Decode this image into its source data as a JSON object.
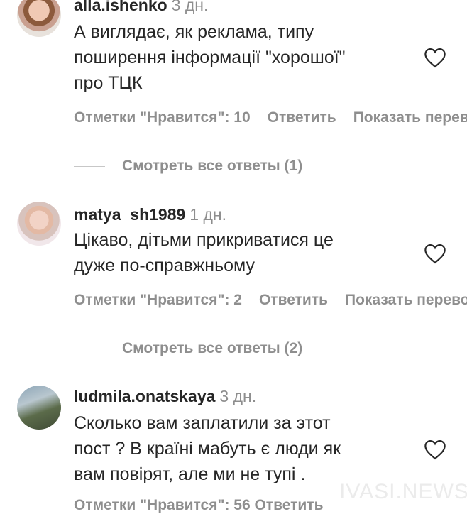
{
  "comments": [
    {
      "username": "alla.ishenko",
      "time": "3 дн.",
      "lines": [
        "А виглядає, як реклама, типу",
        "поширення інформації \"хорошої\"",
        "про ТЦК"
      ],
      "likes": "Отметки \"Нравится\": 10",
      "reply": "Ответить",
      "more": "Показать перевод",
      "view_replies": "Смотреть все ответы (1)"
    },
    {
      "username": "matya_sh1989",
      "time": "1 дн.",
      "lines": [
        "Цікаво, дітьми прикриватися це",
        "дуже по-справжньому"
      ],
      "likes": "Отметки \"Нравится\": 2",
      "reply": "Ответить",
      "more": "Показать перевод",
      "view_replies": "Смотреть все ответы (2)"
    },
    {
      "username": "ludmila.onatskaya",
      "time": "3 дн.",
      "lines": [
        "Сколько вам заплатили за этот",
        "пост ? В країні мабуть є люди як",
        "вам повірят, але ми не тупі ."
      ],
      "partial_actions": "Отметки \"Нравится\": 56   Ответить"
    }
  ],
  "watermark": "IVASI.NEWS"
}
